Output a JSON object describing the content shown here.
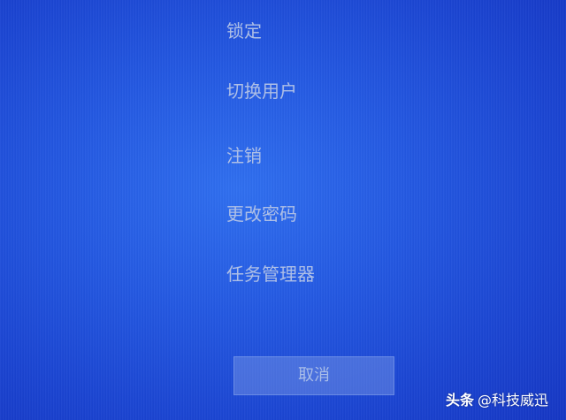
{
  "menu": {
    "items": [
      {
        "label": "锁定"
      },
      {
        "label": "切换用户"
      },
      {
        "label": "注销"
      },
      {
        "label": "更改密码"
      },
      {
        "label": "任务管理器"
      }
    ]
  },
  "cancel_label": "取消",
  "watermark": {
    "brand": "头条",
    "author": "@科技威迅"
  },
  "colors": {
    "background": "#2358e2",
    "menu_text": "#aebfe6",
    "button_fill": "#7f9fe6"
  }
}
